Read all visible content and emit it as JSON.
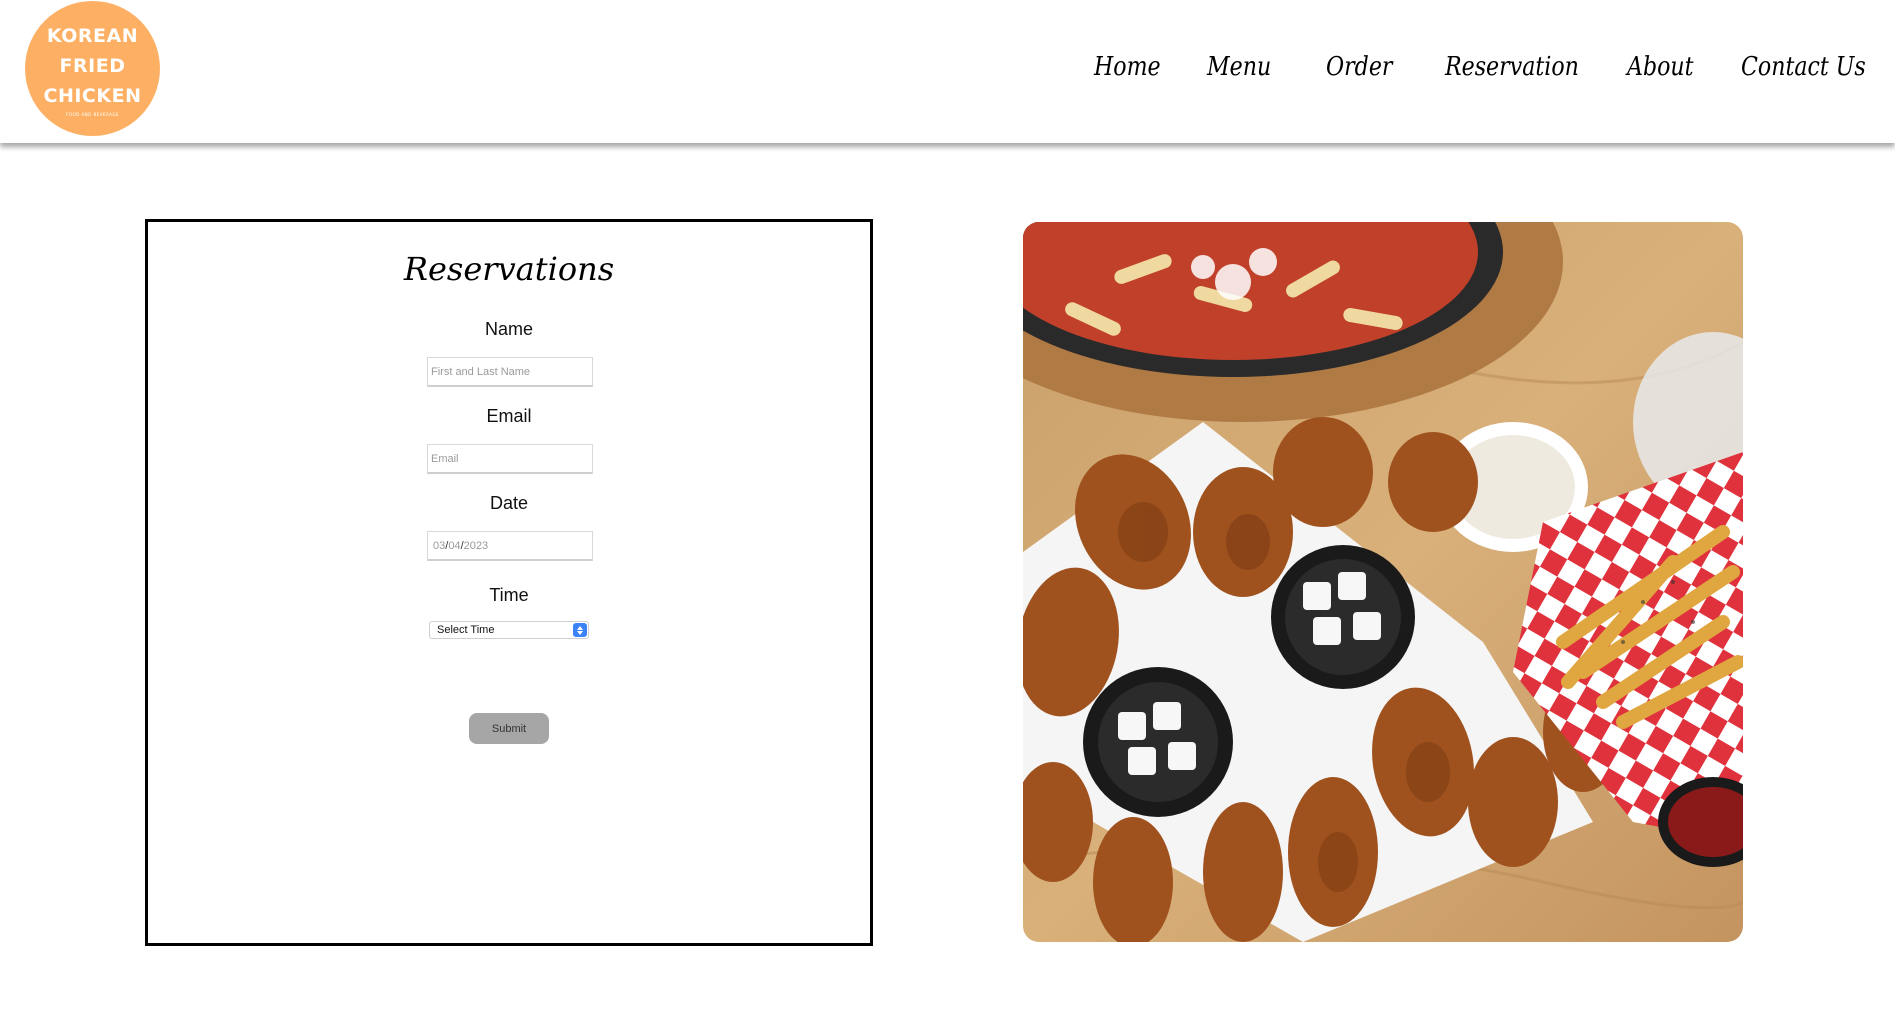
{
  "logo": {
    "lines": [
      "KOREAN",
      "FRIED",
      "CHICKEN"
    ],
    "tagline": "FOOD AND BEVERAGE",
    "color": "#fdb064"
  },
  "nav": {
    "items": [
      {
        "label": "Home"
      },
      {
        "label": "Menu"
      },
      {
        "label": "Order"
      },
      {
        "label": "Reservation"
      },
      {
        "label": "About"
      },
      {
        "label": "Contact Us"
      }
    ]
  },
  "form": {
    "title": "Reservations",
    "name_label": "Name",
    "name_placeholder": "First and Last Name",
    "email_label": "Email",
    "email_placeholder": "Email",
    "date_label": "Date",
    "date_value": {
      "month": "03",
      "day": "04",
      "year": "2023"
    },
    "time_label": "Time",
    "time_selected": "Select Time",
    "submit_label": "Submit"
  },
  "image": {
    "icon": "food-photo-icon"
  }
}
